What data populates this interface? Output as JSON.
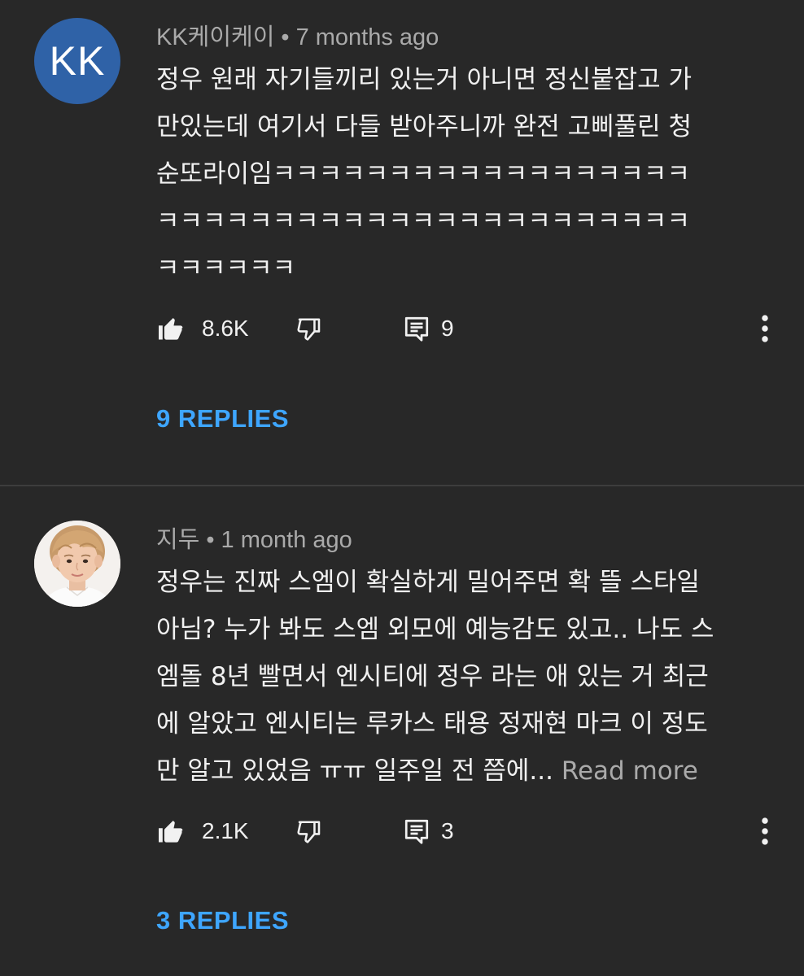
{
  "comments": [
    {
      "avatar_text": "KK",
      "author": "KK케이케이",
      "separator": "•",
      "time": "7 months ago",
      "lines": [
        "정우 원래 자기들끼리 있는거 아니면 정신붙잡고 가",
        "만있는데 여기서 다들 받아주니까 완전 고삐풀린 청",
        "순또라이임ㅋㅋㅋㅋㅋㅋㅋㅋㅋㅋㅋㅋㅋㅋㅋㅋㅋㅋ",
        "ㅋㅋㅋㅋㅋㅋㅋㅋㅋㅋㅋㅋㅋㅋㅋㅋㅋㅋㅋㅋㅋㅋㅋ",
        "ㅋㅋㅋㅋㅋㅋ"
      ],
      "read_more": "",
      "likes": "8.6K",
      "reply_count": "9",
      "replies_label": "9 REPLIES"
    },
    {
      "author": "지두",
      "separator": "•",
      "time": "1 month ago",
      "lines": [
        "정우는 진짜 스엠이 확실하게 밀어주면 확 뜰 스타일",
        "아님? 누가 봐도 스엠 외모에 예능감도 있고.. 나도 스",
        "엠돌 8년 빨면서 엔시티에 정우 라는 애 있는 거 최근",
        "에 알았고 엔시티는 루카스 태용 정재현 마크 이 정도",
        "만 알고 있었음 ㅠㅠ 일주일 전 쯤에..."
      ],
      "read_more": "Read more",
      "likes": "2.1K",
      "reply_count": "3",
      "replies_label": "3 REPLIES"
    }
  ],
  "colors": {
    "background": "#282828",
    "text": "#f1f1f1",
    "secondary_text": "#aaaaaa",
    "link": "#3ea6ff",
    "avatar_kk": "#2f62a7"
  },
  "icons": {
    "like": "thumbs-up-icon",
    "dislike": "thumbs-down-icon",
    "reply": "comment-icon",
    "more": "more-vertical-icon"
  }
}
